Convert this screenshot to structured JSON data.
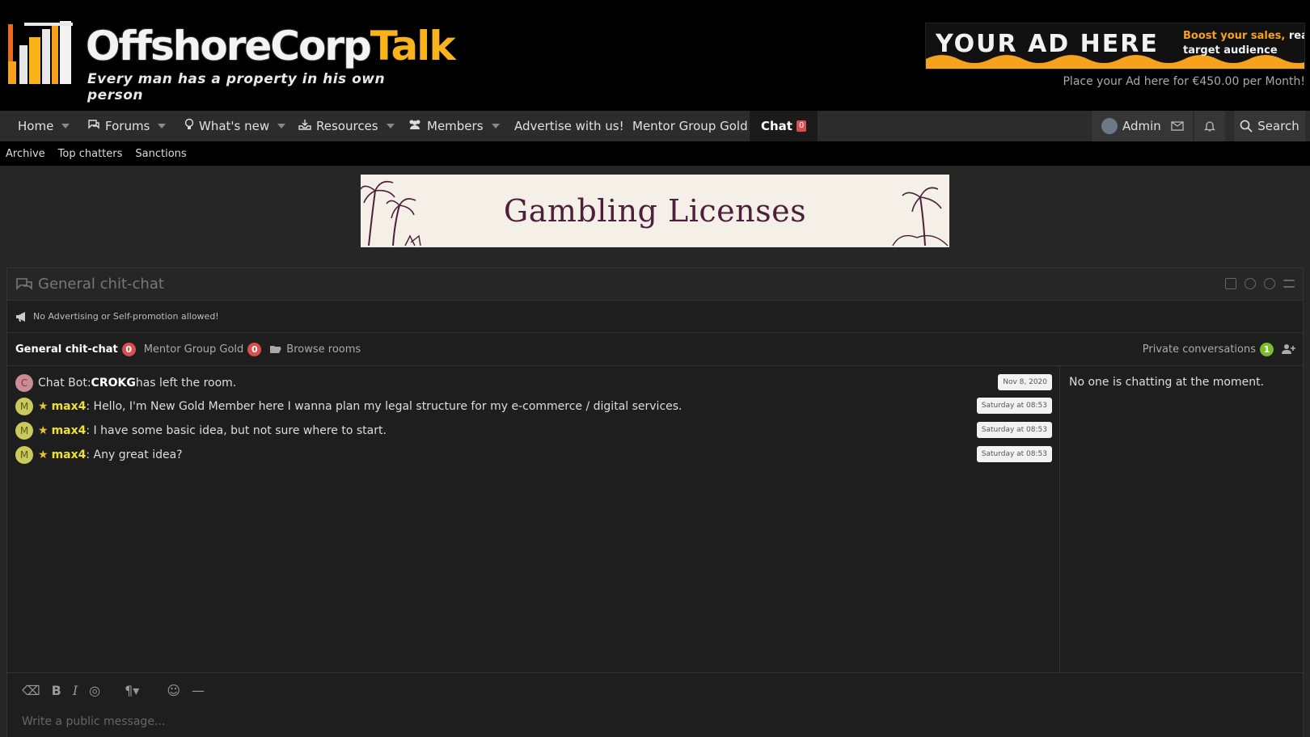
{
  "header": {
    "logo_part1": "OffshoreCorp",
    "logo_part2": "Talk",
    "tagline": "Every man has a property in his own person",
    "ad": {
      "title": "YOUR AD HERE",
      "sub_orange": "Boost your sales,",
      "sub_white": " reach c",
      "sub_line2": "target audience",
      "caption": "Place your Ad here for €450.00 per Month!"
    }
  },
  "nav": {
    "home": "Home",
    "forums": "Forums",
    "whats_new": "What's new",
    "resources": "Resources",
    "members": "Members",
    "advertise": "Advertise with us!",
    "mentor": "Mentor Group Gold",
    "chat": "Chat",
    "chat_count": "0",
    "admin": "Admin",
    "search": "Search"
  },
  "subnav": {
    "archive": "Archive",
    "top_chatters": "Top chatters",
    "sanctions": "Sanctions"
  },
  "banner": {
    "text": "Gambling Licenses"
  },
  "chat": {
    "title": "General chit-chat",
    "notice": "No Advertising or Self-promotion allowed!",
    "tabs": {
      "general": "General chit-chat",
      "general_count": "0",
      "mentor": "Mentor Group Gold",
      "mentor_count": "0",
      "browse": "Browse rooms",
      "private": "Private conversations",
      "private_count": "1"
    },
    "messages": [
      {
        "avatar": "C",
        "prefix": "Chat Bot: ",
        "bold": "CROKG",
        "text": " has left the room.",
        "time": "Nov 8, 2020"
      },
      {
        "avatar": "M",
        "user": "max4",
        "text": ": Hello, I'm New Gold Member here I wanna plan my legal structure for my e-commerce / digital services.",
        "time": "Saturday at 08:53"
      },
      {
        "avatar": "M",
        "user": "max4",
        "text": ": I have some basic idea, but not sure where to start.",
        "time": "Saturday at 08:53"
      },
      {
        "avatar": "M",
        "user": "max4",
        "text": ": Any great idea?",
        "time": "Saturday at 08:53"
      }
    ],
    "no_one": "No one is chatting at the moment.",
    "placeholder": "Write a public message..."
  },
  "colors": {
    "accent_orange": "#f7b21c",
    "badge_red": "#d94e4e",
    "badge_green": "#7cba2f",
    "gold_user": "#f0e22c"
  }
}
